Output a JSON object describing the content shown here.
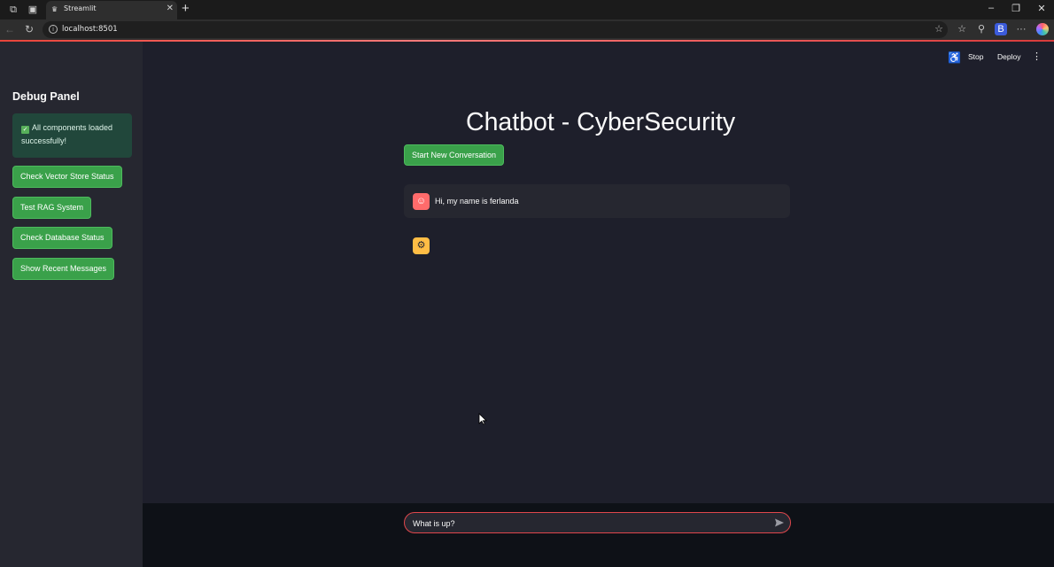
{
  "browser": {
    "tab_title": "Streamlit",
    "url": "localhost:8501"
  },
  "sidebar": {
    "title": "Debug Panel",
    "alert_text": "All components loaded successfully!",
    "buttons": [
      {
        "label": "Check Vector Store Status"
      },
      {
        "label": "Test RAG System"
      },
      {
        "label": "Check Database Status"
      },
      {
        "label": "Show Recent Messages"
      }
    ]
  },
  "header": {
    "stop_label": "Stop",
    "deploy_label": "Deploy"
  },
  "main": {
    "title": "Chatbot - CyberSecurity",
    "new_conversation_label": "Start New Conversation",
    "messages": [
      {
        "role": "user",
        "text": "Hi, my name is ferlanda"
      },
      {
        "role": "assistant",
        "text": ""
      }
    ]
  },
  "chat_input": {
    "value": "What is up?"
  },
  "colors": {
    "accent_green": "#3aa14a",
    "user_avatar": "#ff6b6b",
    "bot_avatar": "#ffbd45",
    "input_border": "#e0474c"
  }
}
